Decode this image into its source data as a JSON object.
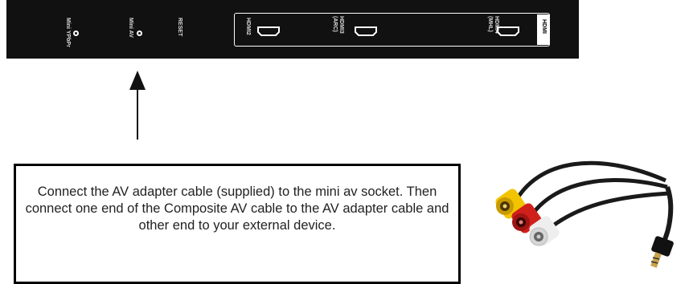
{
  "panel": {
    "ports": [
      {
        "label": "Mini YPbPr"
      },
      {
        "label": "Mini AV"
      },
      {
        "label": "RESET"
      }
    ],
    "hdmi_ports": [
      {
        "label": "HDMI2"
      },
      {
        "label": "HDMI3\n(ARC)"
      },
      {
        "label": "HDMI4\n(MHL)"
      }
    ],
    "hdmi_tab": "HDMI"
  },
  "instruction": {
    "text": "Connect the AV adapter cable (supplied) to the mini av socket. Then connect one end of the Composite  AV cable to the AV adapter cable and other end to your external device."
  },
  "colors": {
    "panel": "#111111",
    "rca_yellow": "#f2c400",
    "rca_red": "#d0201c",
    "rca_white": "#eeeeee"
  }
}
